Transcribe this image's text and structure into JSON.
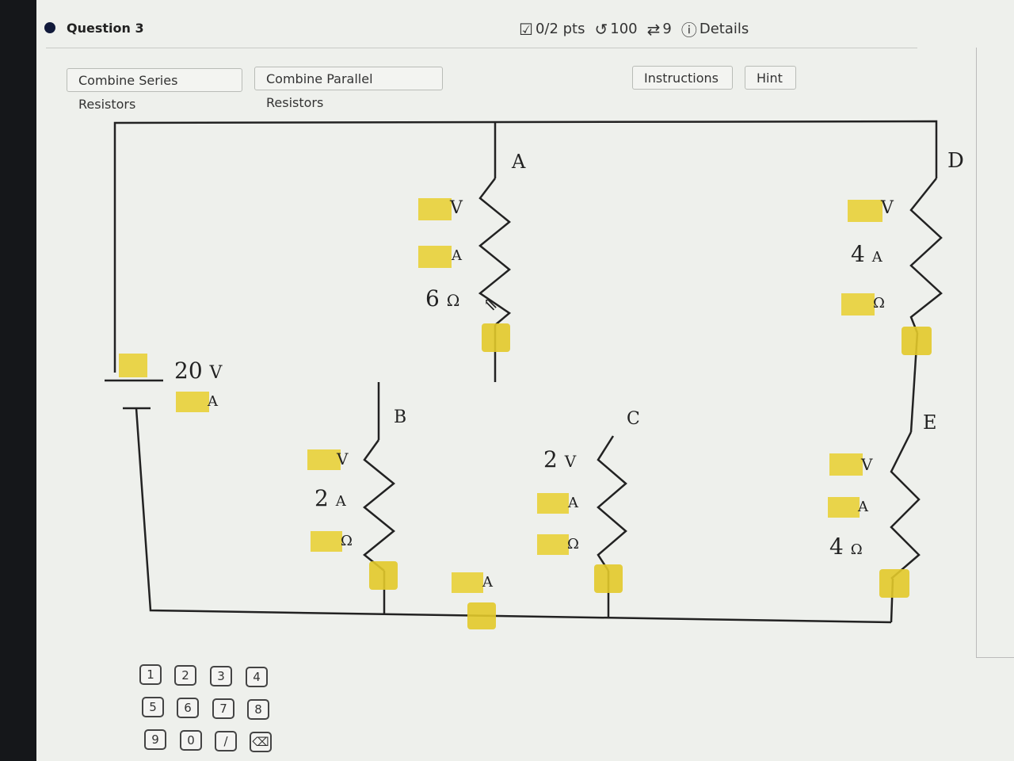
{
  "question": {
    "title": "Question 3"
  },
  "meta": {
    "score": "0/2 pts",
    "attempts": "100",
    "retries": "9",
    "details": "Details"
  },
  "toolbar": {
    "series": "Combine Series Resistors",
    "parallel": "Combine Parallel Resistors",
    "instructions": "Instructions",
    "hint": "Hint"
  },
  "circuit": {
    "source": {
      "voltage": "20",
      "voltage_unit": "V",
      "current_unit": "A"
    },
    "A": {
      "name": "A",
      "v_unit": "V",
      "a_unit": "A",
      "resistance": "6",
      "ohm": "Ω"
    },
    "B": {
      "name": "B",
      "v_unit": "V",
      "current": "2",
      "a_unit": "A",
      "ohm": "Ω"
    },
    "C": {
      "name": "C",
      "voltage": "2",
      "v_unit": "V",
      "a_unit": "A",
      "ohm": "Ω"
    },
    "D": {
      "name": "D",
      "v_unit": "V",
      "current": "4",
      "a_unit": "A",
      "ohm": "Ω"
    },
    "E": {
      "name": "E",
      "v_unit": "V",
      "a_unit": "A",
      "resistance": "4",
      "ohm": "Ω"
    },
    "bottom": {
      "a_unit": "A"
    }
  },
  "keypad": [
    "1",
    "2",
    "3",
    "4",
    "5",
    "6",
    "7",
    "8",
    "9",
    "0",
    "/",
    "⌫"
  ]
}
